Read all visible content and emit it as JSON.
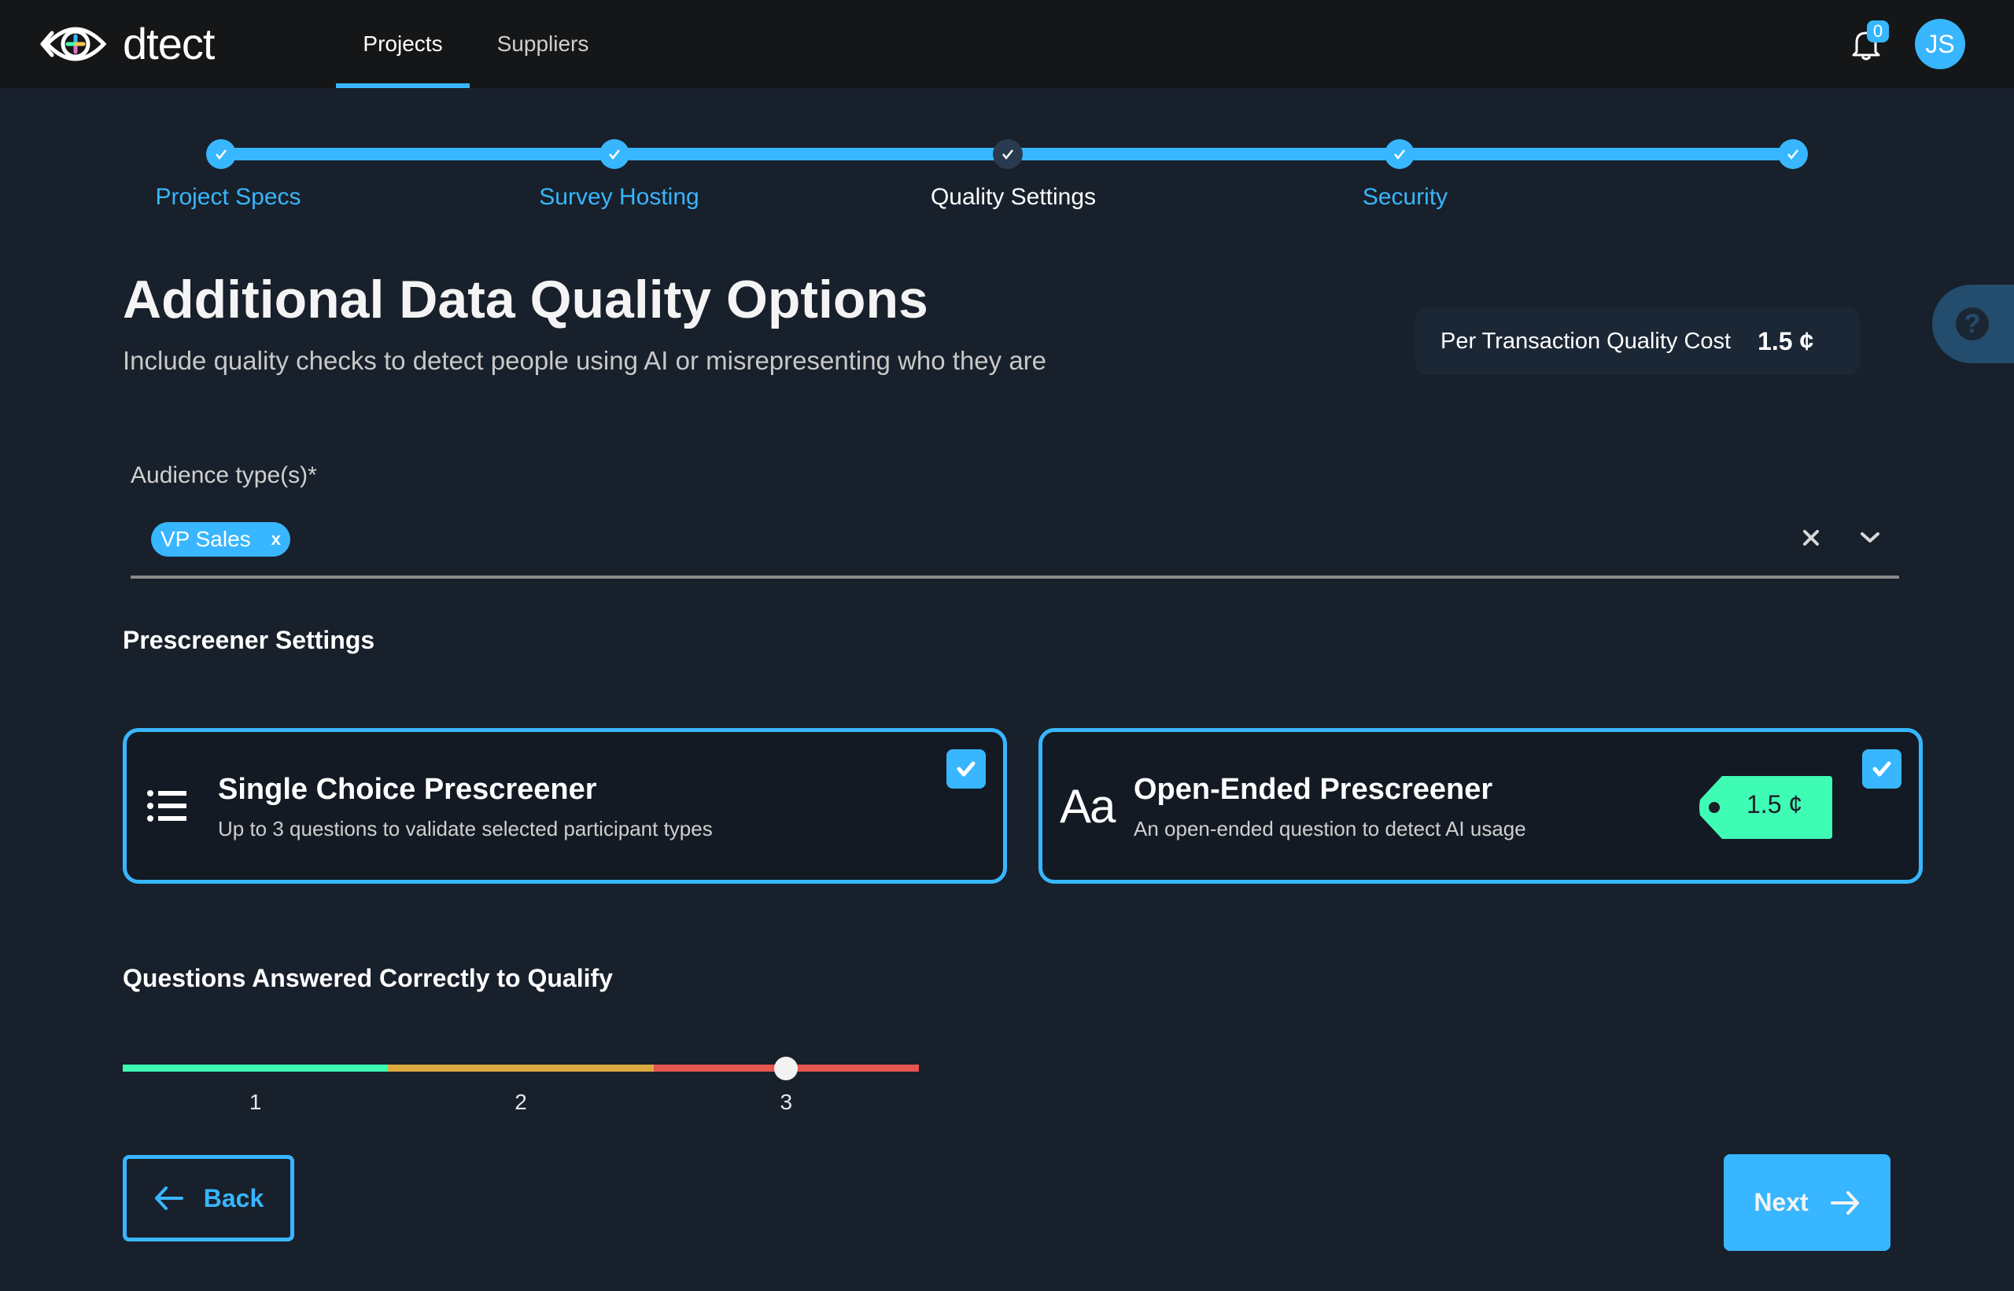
{
  "header": {
    "brand": "dtect",
    "logo_icon": "eye-plus-logo",
    "nav": [
      {
        "label": "Projects",
        "active": true
      },
      {
        "label": "Suppliers",
        "active": false
      }
    ],
    "notifications": {
      "icon": "bell-icon",
      "count": "0"
    },
    "avatar_initials": "JS"
  },
  "stepper": {
    "steps": [
      {
        "label": "Project Specs",
        "state": "complete"
      },
      {
        "label": "Survey Hosting",
        "state": "complete"
      },
      {
        "label": "Quality Settings",
        "state": "current"
      },
      {
        "label": "Security",
        "state": "complete"
      },
      {
        "label": "",
        "state": "complete"
      }
    ]
  },
  "page": {
    "title": "Additional Data Quality Options",
    "subtitle": "Include quality checks to detect people using AI or misrepresenting who they are"
  },
  "cost": {
    "label": "Per Transaction Quality Cost",
    "value": "1.5 ¢"
  },
  "help": {
    "icon": "question-icon",
    "glyph": "?"
  },
  "audience": {
    "label": "Audience type(s)*",
    "chips": [
      {
        "label": "VP Sales",
        "remove": "x"
      }
    ]
  },
  "prescreener": {
    "section_title": "Prescreener Settings",
    "cards": [
      {
        "title": "Single Choice Prescreener",
        "description": "Up to 3 questions to validate selected participant types",
        "icon": "list-icon",
        "checked": true
      },
      {
        "title": "Open-Ended Prescreener",
        "description": "An open-ended question to detect AI usage",
        "icon": "text-aa-icon",
        "icon_text": "Aa",
        "price": "1.5 ¢",
        "checked": true
      }
    ]
  },
  "qualify": {
    "title": "Questions Answered Correctly to Qualify",
    "ticks": [
      "1",
      "2",
      "3"
    ],
    "value": 3,
    "segment_colors": [
      "#3ffcb4",
      "#dcaa3f",
      "#e65550"
    ]
  },
  "buttons": {
    "back": "Back",
    "next": "Next"
  },
  "colors": {
    "accent": "#38b6ff",
    "background": "#18202b",
    "topbar": "#151617",
    "price_tag": "#3ffcb4"
  }
}
